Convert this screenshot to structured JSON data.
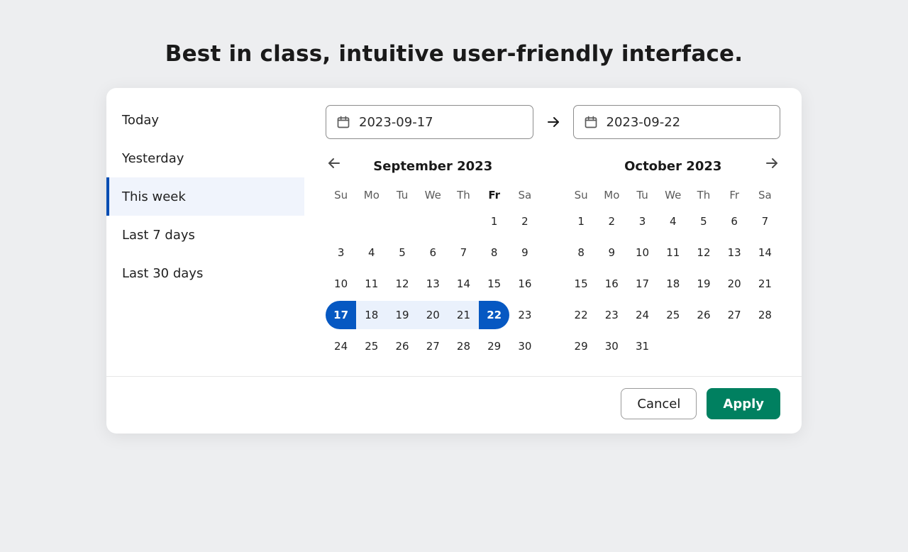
{
  "heading": "Best in class, intuitive user-friendly interface.",
  "presets": [
    {
      "label": "Today",
      "active": false
    },
    {
      "label": "Yesterday",
      "active": false
    },
    {
      "label": "This week",
      "active": true
    },
    {
      "label": "Last 7 days",
      "active": false
    },
    {
      "label": "Last 30 days",
      "active": false
    }
  ],
  "start_date": "2023-09-17",
  "end_date": "2023-09-22",
  "dow": [
    "Su",
    "Mo",
    "Tu",
    "We",
    "Th",
    "Fr",
    "Sa"
  ],
  "today_dow_index": 5,
  "months": [
    {
      "title": "September 2023",
      "lead_blanks": 5,
      "days": 30,
      "range_start": 17,
      "range_end": 22
    },
    {
      "title": "October 2023",
      "lead_blanks": 0,
      "days": 31,
      "range_start": null,
      "range_end": null
    }
  ],
  "buttons": {
    "cancel": "Cancel",
    "apply": "Apply"
  },
  "colors": {
    "accent_blue": "#0658c2",
    "range_bg": "#eaf1fc",
    "apply_green": "#008060"
  }
}
